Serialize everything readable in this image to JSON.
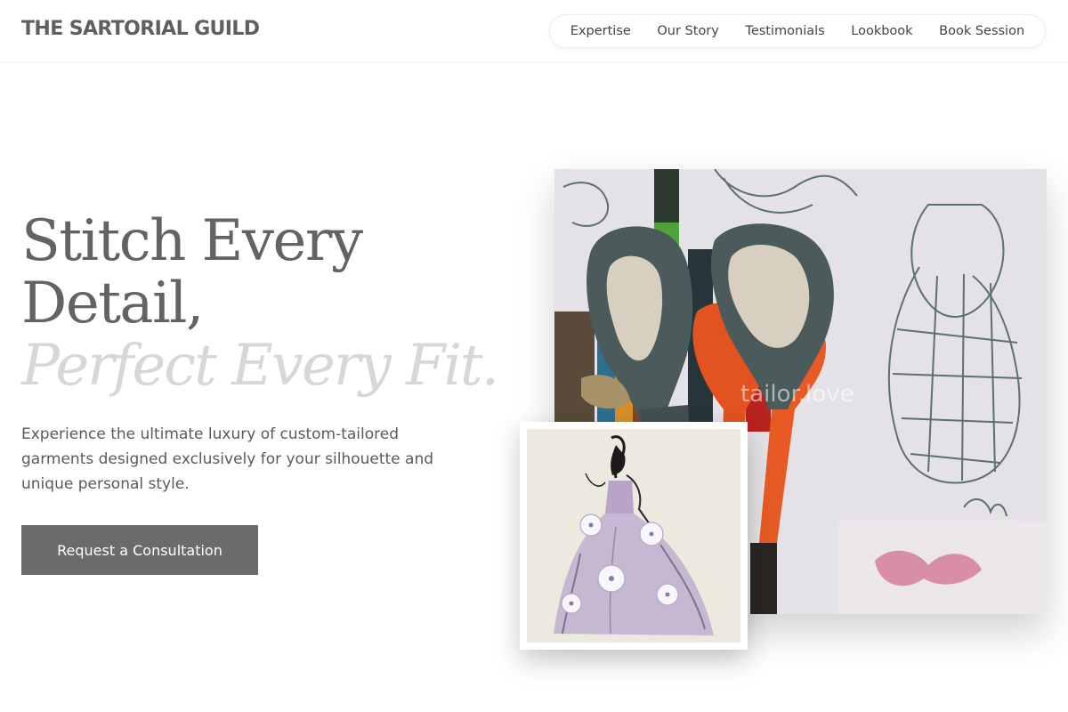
{
  "header": {
    "brand": "THE SARTORIAL GUILD",
    "nav": [
      {
        "label": "Expertise"
      },
      {
        "label": "Our Story"
      },
      {
        "label": "Testimonials"
      },
      {
        "label": "Lookbook"
      },
      {
        "label": "Book Session"
      }
    ]
  },
  "hero": {
    "headline_line1": "Stitch Every",
    "headline_line2": "Detail,",
    "headline_accent": "Perfect Every Fit.",
    "subtitle": "Experience the ultimate luxury of custom-tailored garments designed exclusively for your silhouette and unique personal style.",
    "cta_label": "Request a Consultation"
  },
  "gallery": {
    "main_image_watermark": "tailor.love",
    "main_image_subject": "scissors-and-pencils-photo",
    "inset_image_subject": "gown-sketch-illustration"
  },
  "colors": {
    "text_dark": "#636363",
    "accent_light": "#d7d7d7",
    "button_bg": "#6b6b6b",
    "button_text": "#ffffff",
    "scissor_orange": "#e2531f",
    "scissor_gray": "#4b5a5a"
  }
}
